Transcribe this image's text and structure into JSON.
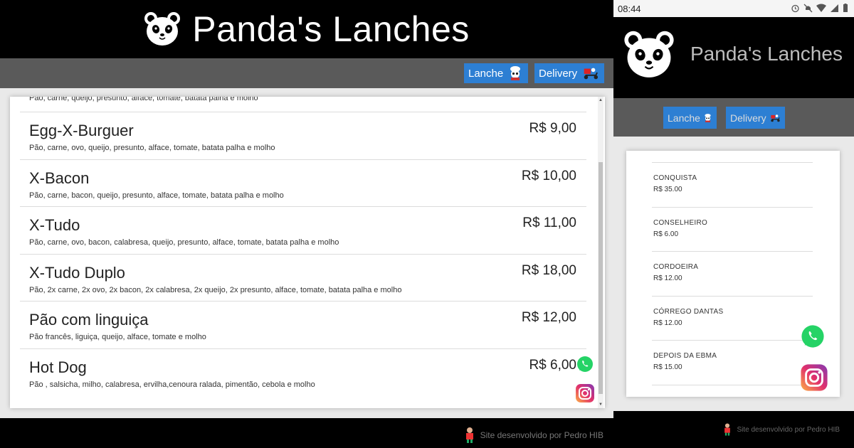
{
  "brand": {
    "title": "Panda's Lanches",
    "accent": "#2d7fd3",
    "header_bg": "#000000",
    "nav_bg": "#5a5a5a"
  },
  "nav": {
    "lanche_label": "Lanche",
    "delivery_label": "Delivery"
  },
  "menu": [
    {
      "name": "",
      "price": "",
      "desc": "Pão, carne, queijo, presunto, alface, tomate, batata palha e molho"
    },
    {
      "name": "Egg-X-Burguer",
      "price": "R$ 9,00",
      "desc": "Pão, carne, ovo, queijo, presunto, alface, tomate, batata palha e molho"
    },
    {
      "name": "X-Bacon",
      "price": "R$ 10,00",
      "desc": "Pão, carne, bacon, queijo, presunto, alface, tomate, batata palha e molho"
    },
    {
      "name": "X-Tudo",
      "price": "R$ 11,00",
      "desc": "Pão, carne, ovo, bacon, calabresa, queijo, presunto, alface, tomate, batata palha e molho"
    },
    {
      "name": "X-Tudo Duplo",
      "price": "R$ 18,00",
      "desc": "Pão, 2x carne, 2x ovo, 2x bacon, 2x calabresa, 2x queijo, 2x presunto, alface, tomate, batata palha e molho"
    },
    {
      "name": "Pão com linguiça",
      "price": "R$ 12,00",
      "desc": "Pão francês, liguiça, queijo, alface, tomate e molho"
    },
    {
      "name": "Hot Dog",
      "price": "R$ 6,00",
      "desc": "Pão , salsicha, milho, calabresa, ervilha,cenoura ralada, pimentão, cebola e molho"
    }
  ],
  "footer": {
    "credit": "Site desenvolvido por Pedro HIB"
  },
  "mobile": {
    "status_time": "08:44",
    "delivery_areas": [
      {
        "name": "CONQUISTA",
        "price": "R$ 35.00"
      },
      {
        "name": "CONSELHEIRO",
        "price": "R$ 6.00"
      },
      {
        "name": "CORDOEIRA",
        "price": "R$ 12.00"
      },
      {
        "name": "CÓRREGO DANTAS",
        "price": "R$ 12.00"
      },
      {
        "name": "DEPOIS DA EBMA",
        "price": "R$ 15.00"
      }
    ]
  },
  "icons": {
    "logo": "panda-face-icon",
    "lanche": "panda-chef-icon",
    "delivery": "delivery-scooter-icon",
    "whatsapp": "whatsapp-icon",
    "instagram": "instagram-icon",
    "credit": "developer-avatar-icon"
  }
}
